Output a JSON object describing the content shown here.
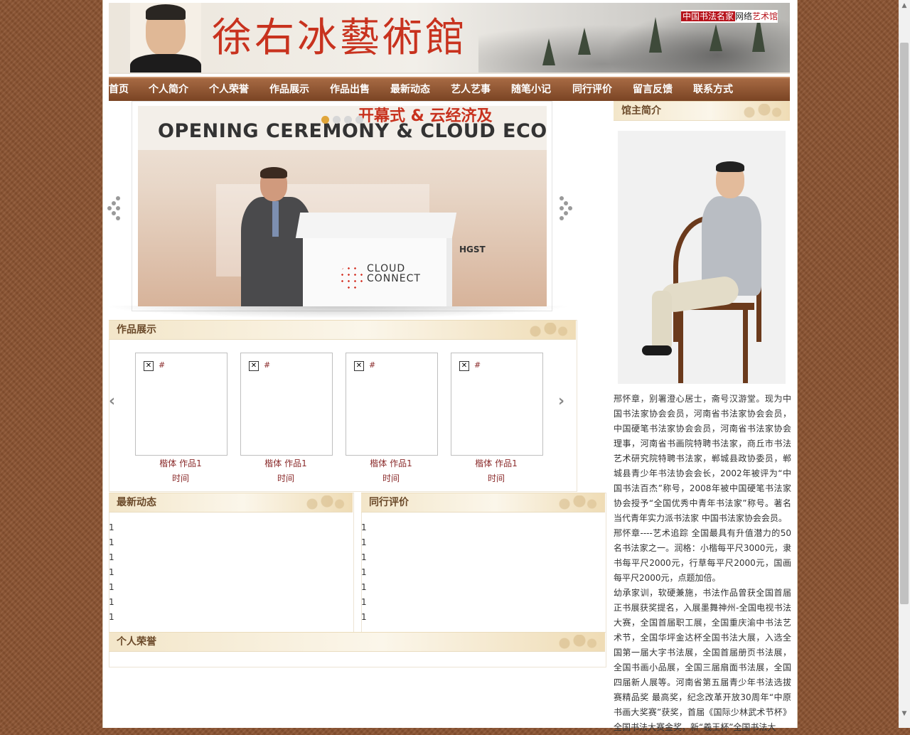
{
  "header": {
    "title": "徐右冰藝術館",
    "brand_part1": "中国书法名家",
    "brand_part2": "网络",
    "brand_part3": "艺术馆"
  },
  "nav": {
    "items": [
      "首页",
      "个人简介",
      "个人荣誉",
      "作品展示",
      "作品出售",
      "最新动态",
      "艺人艺事",
      "随笔小记",
      "同行评价",
      "留言反馈",
      "联系方式"
    ]
  },
  "slider": {
    "heading_cn": "开幕式 & 云经济及",
    "heading_en": "OPENING CEREMONY & CLOUD ECONOM",
    "logo_text_line1": "CLOUD",
    "logo_text_line2": "CONNECT",
    "sponsor": "HGST",
    "active_index": 1,
    "dot_count": 4
  },
  "works": {
    "title": "作品展示",
    "items": [
      {
        "link": "#",
        "name": "楷体 作品1",
        "time": "时间"
      },
      {
        "link": "#",
        "name": "楷体 作品1",
        "time": "时间"
      },
      {
        "link": "#",
        "name": "楷体 作品1",
        "time": "时间"
      },
      {
        "link": "#",
        "name": "楷体 作品1",
        "time": "时间"
      }
    ]
  },
  "news": {
    "title": "最新动态",
    "items": [
      "1",
      "1",
      "1",
      "1",
      "1",
      "1",
      "1"
    ]
  },
  "reviews": {
    "title": "同行评价",
    "items": [
      "1",
      "1",
      "1",
      "1",
      "1",
      "1",
      "1"
    ]
  },
  "honors": {
    "title": "个人荣誉"
  },
  "about": {
    "title": "馆主简介",
    "paragraphs": [
      "邢怀章，别署澄心居士，斋号汉游堂。现为中国书法家协会会员，河南省书法家协会会员，中国硬笔书法家协会会员，河南省书法家协会理事，河南省书画院特聘书法家，商丘市书法艺术研究院特聘书法家，郸城县政协委员，郸城县青少年书法协会会长，2002年被评为“中国书法百杰”称号，2008年被中国硬笔书法家协会授予“全国优秀中青年书法家”称号。著名当代青年实力派书法家 中国书法家协会会员。",
      "邢怀章----艺术追踪 全国最具有升值潜力的50名书法家之一。润格：小楷每平尺3000元，隶书每平尺2000元，行草每平尺2000元，国画每平尺2000元，点题加倍。",
      "幼承家训，软硬兼施，书法作品曾获全国首届正书展获奖提名，入展墨舞神州-全国电视书法大赛，全国首届职工展，全国重庆渝中书法艺术节，全国华坪金达杯全国书法大展，入选全国第一届大字书法展，全国首届册页书法展，全国书画小品展，全国三届扇面书法展，全国四届新人展等。河南省第五届青少年书法选拔赛精品奖 最高奖，纪念改革开放30周年“中原书画大奖赛”获奖，首届《国际少林武术节杯》全国书法大赛金奖，新“羲王杯”全国书法大"
    ]
  },
  "colors": {
    "nav_brown": "#7a4424",
    "title_red": "#c8321e",
    "link_red": "#8a2a2a",
    "section_title": "#6b4a2a",
    "slider_active_dot": "#e0a53a"
  },
  "icons": {
    "slider_prev": "dotted-arrow-left-icon",
    "slider_next": "dotted-arrow-right-icon",
    "works_prev": "chevron-left-icon",
    "works_next": "chevron-right-icon",
    "broken_image": "broken-image-icon"
  }
}
